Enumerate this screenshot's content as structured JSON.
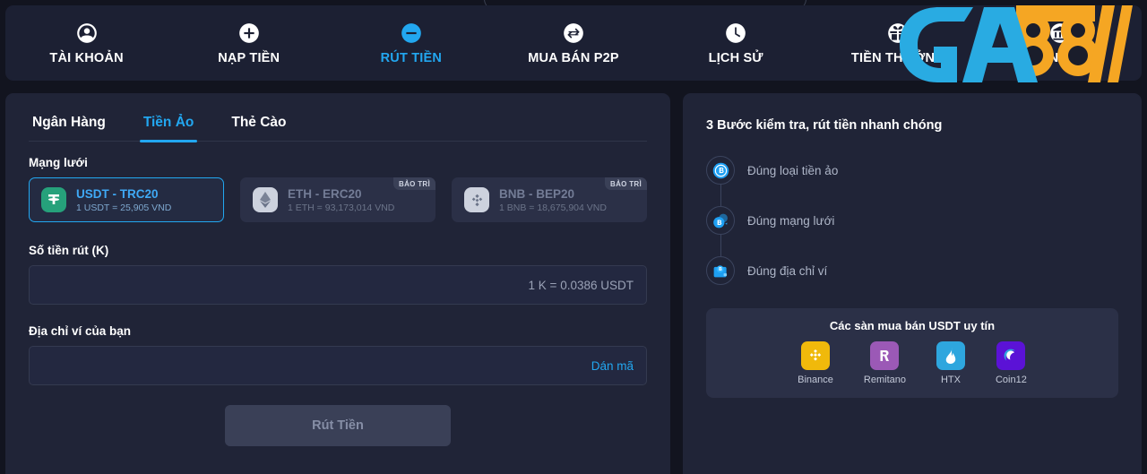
{
  "brand": {
    "name": "GA88",
    "text_blue": "GA",
    "text_gold": "88",
    "color_blue": "#29ABE2",
    "color_gold": "#F5A623"
  },
  "nav": {
    "items": [
      {
        "label": "TÀI KHOẢN",
        "icon": "user-circle-icon",
        "active": false
      },
      {
        "label": "NẠP TIỀN",
        "icon": "plus-circle-icon",
        "active": false
      },
      {
        "label": "RÚT TIỀN",
        "icon": "minus-circle-icon",
        "active": true
      },
      {
        "label": "MUA BÁN P2P",
        "icon": "exchange-arrows-icon",
        "active": false
      },
      {
        "label": "LỊCH SỬ",
        "icon": "clock-icon",
        "active": false
      },
      {
        "label": "TIỀN THƯỞNG",
        "icon": "gift-icon",
        "active": false
      },
      {
        "label": "NGÂN HÀNG",
        "icon": "bank-icon",
        "active": false
      }
    ],
    "active_color": "#22a7f0"
  },
  "tabs": [
    {
      "label": "Ngân Hàng",
      "active": false
    },
    {
      "label": "Tiền Ảo",
      "active": true
    },
    {
      "label": "Thẻ Cào",
      "active": false
    }
  ],
  "form": {
    "network_label": "Mạng lưới",
    "networks": [
      {
        "name": "USDT - TRC20",
        "rate": "1 USDT = 25,905 VND",
        "icon": "tether-icon",
        "selected": true,
        "disabled": false,
        "badge": ""
      },
      {
        "name": "ETH - ERC20",
        "rate": "1 ETH = 93,173,014 VND",
        "icon": "ethereum-icon",
        "selected": false,
        "disabled": true,
        "badge": "BẢO TRÌ"
      },
      {
        "name": "BNB - BEP20",
        "rate": "1 BNB = 18,675,904 VND",
        "icon": "binance-chain-icon",
        "selected": false,
        "disabled": true,
        "badge": "BẢO TRÌ"
      }
    ],
    "amount_label": "Số tiền rút (K)",
    "amount_value": "",
    "amount_placeholder": "",
    "amount_hint": "1 K = 0.0386 USDT",
    "wallet_label": "Địa chỉ ví của bạn",
    "wallet_value": "",
    "wallet_placeholder": "",
    "paste_label": "Dán mã",
    "submit_label": "Rút Tiền"
  },
  "guide": {
    "title": "3 Bước kiểm tra, rút tiền nhanh chóng",
    "steps": [
      {
        "label": "Đúng loại tiền ảo",
        "icon": "bitcoin-coin-icon"
      },
      {
        "label": "Đúng mạng lưới",
        "icon": "coins-network-icon"
      },
      {
        "label": "Đúng địa chỉ ví",
        "icon": "wallet-icon"
      }
    ]
  },
  "exchanges": {
    "title": "Các sàn mua bán USDT uy tín",
    "items": [
      {
        "name": "Binance",
        "icon": "binance-icon",
        "color": "#F0B90B"
      },
      {
        "name": "Remitano",
        "icon": "remitano-icon",
        "color": "#9B59B6"
      },
      {
        "name": "HTX",
        "icon": "htx-icon",
        "color": "#2EA6DE"
      },
      {
        "name": "Coin12",
        "icon": "coin12-icon",
        "color": "#5B12D6"
      }
    ]
  }
}
